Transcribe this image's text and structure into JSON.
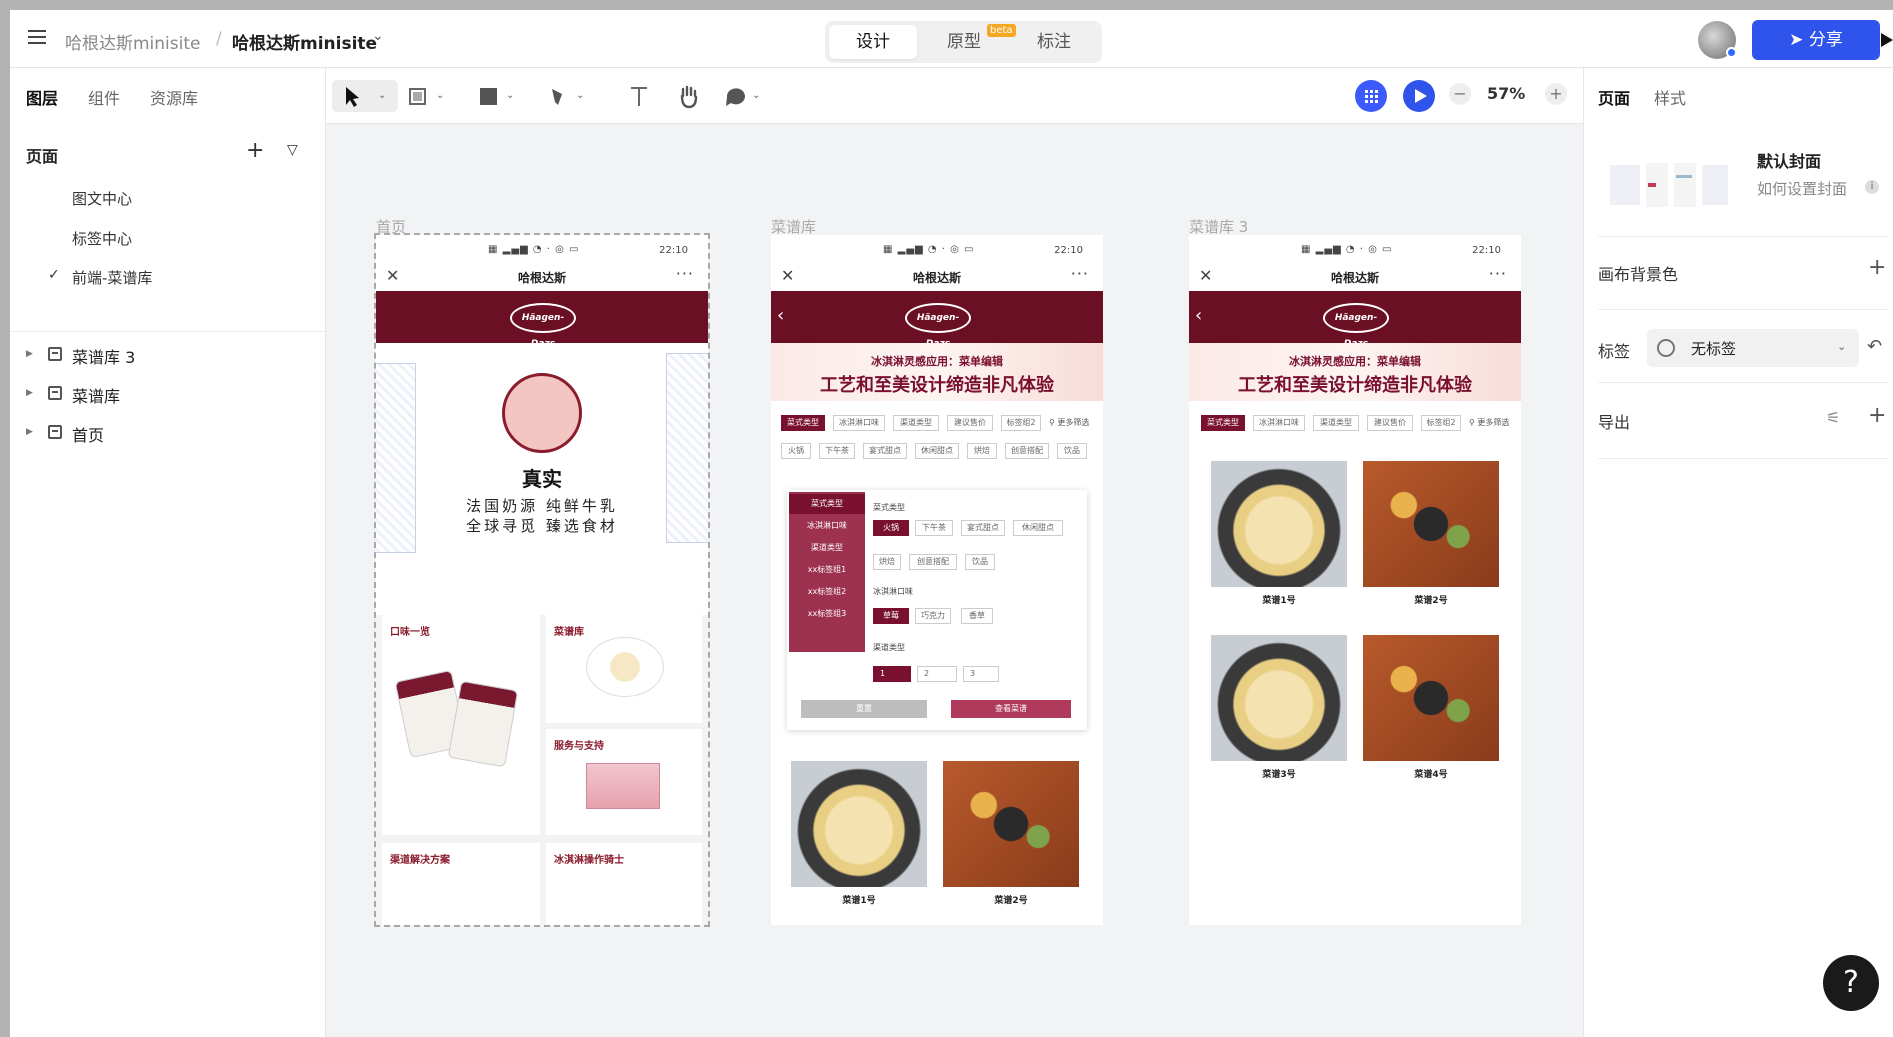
{
  "header": {
    "breadcrumb_parent": "哈根达斯minisite",
    "breadcrumb_sep": "/",
    "breadcrumb_current": "哈根达斯minisite",
    "modes": [
      "设计",
      "原型",
      "标注"
    ],
    "beta": "beta",
    "share_label": "分享"
  },
  "left_panel": {
    "tabs": [
      "图层",
      "组件",
      "资源库"
    ],
    "pages_title": "页面",
    "pages": [
      "图文中心",
      "标签中心",
      "前端-菜谱库"
    ],
    "layers": [
      "菜谱库 3",
      "菜谱库",
      "首页"
    ]
  },
  "toolbar": {
    "zoom": "57%",
    "zoom_minus": "−",
    "zoom_plus": "+"
  },
  "right_panel": {
    "tabs": [
      "页面",
      "样式"
    ],
    "cover_title": "默认封面",
    "cover_link": "如何设置封面",
    "canvas_bg": "画布背景色",
    "tag_label": "标签",
    "tag_value": "无标签",
    "export_label": "导出"
  },
  "help": "?",
  "frames": {
    "home": {
      "label": "首页",
      "hero_title": "真实",
      "hero_line1": "法国奶源 纯鲜牛乳",
      "hero_line2": "全球寻觅 臻选食材",
      "cards": [
        "口味一览",
        "菜谱库",
        "服务与支持",
        "渠道解决方案",
        "冰淇淋操作骑士"
      ]
    },
    "lib": {
      "label": "菜谱库"
    },
    "lib3": {
      "label": "菜谱库 3"
    },
    "phone": {
      "time": "22:10",
      "title": "哈根达斯",
      "logo": "Häagen-Dazs",
      "banner_small": "冰淇淋灵感应用：菜单编辑",
      "banner_big": "工艺和至美设计缔造非凡体验",
      "filter_tabs": [
        "菜式类型",
        "冰淇淋口味",
        "渠道类型",
        "建议售价",
        "标签组2"
      ],
      "filter_more": "更多筛选",
      "sub_chips": [
        "火锅",
        "下午茶",
        "宴式甜点",
        "休闲甜点",
        "烘焙",
        "创意搭配",
        "饮品"
      ],
      "side_items": [
        "菜式类型",
        "冰淇淋口味",
        "渠道类型",
        "xx标签组1",
        "xx标签组2",
        "xx标签组3"
      ],
      "group1_label": "菜式类型",
      "group1_opts": [
        "火锅",
        "下午茶",
        "宴式甜点",
        "休闲甜点",
        "烘焙",
        "创意搭配",
        "饮品"
      ],
      "group2_label": "冰淇淋口味",
      "group2_opts": [
        "草莓",
        "巧克力",
        "香草"
      ],
      "group3_label": "渠道类型",
      "group3_opts": [
        "1",
        "2",
        "3"
      ],
      "reset": "重置",
      "view": "查看菜谱",
      "recipes": [
        "菜谱1号",
        "菜谱2号",
        "菜谱3号",
        "菜谱4号"
      ]
    }
  }
}
